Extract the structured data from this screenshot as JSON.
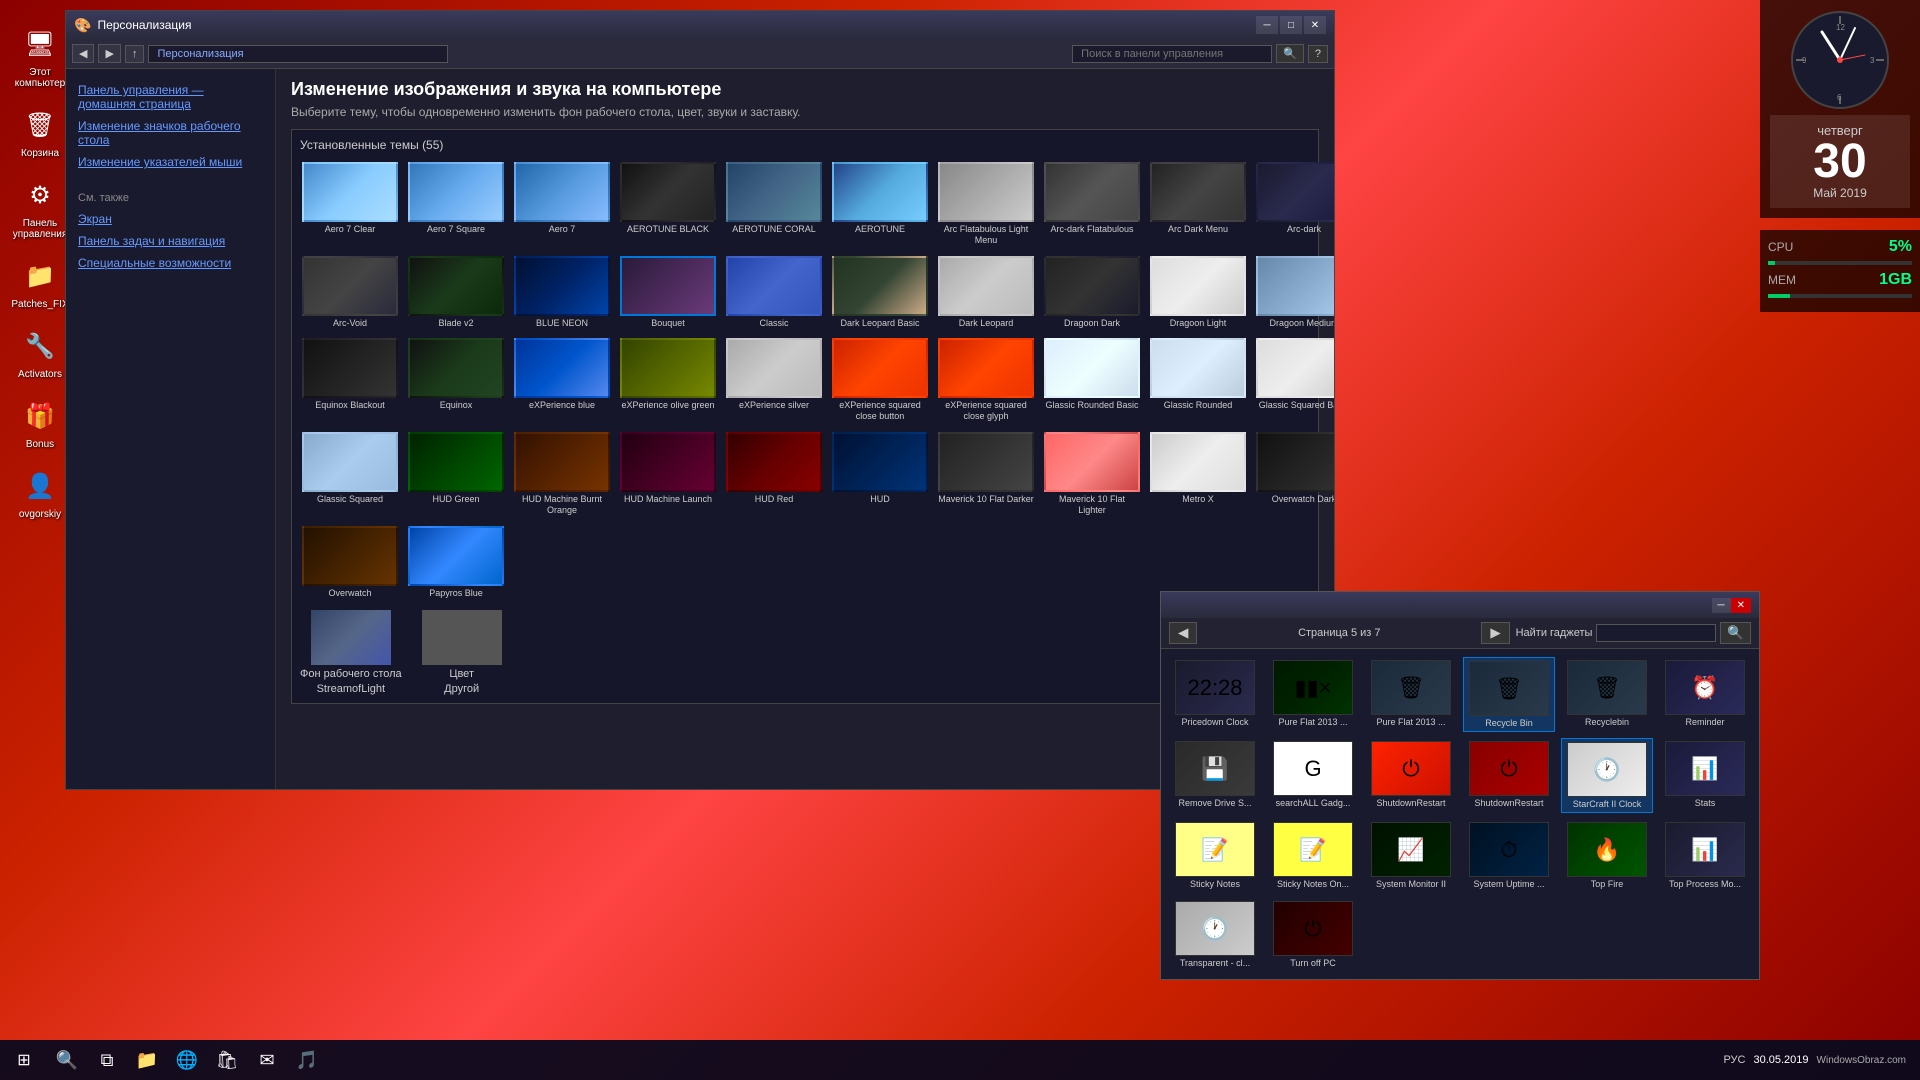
{
  "app": {
    "title": "Персонализация",
    "nav_path": "Персонализация",
    "search_placeholder": "Поиск в панели управления"
  },
  "sidebar": {
    "main_link": "Панель управления — домашняя страница",
    "link1": "Изменение значков рабочего стола",
    "link2": "Изменение указателей мыши",
    "see_also": "См. также",
    "sub_links": [
      "Экран",
      "Панель задач и навигация",
      "Специальные возможности"
    ]
  },
  "main": {
    "title": "Изменение изображения и звука на компьютере",
    "subtitle": "Выберите тему, чтобы одновременно изменить фон рабочего стола, цвет, звуки и заставку.",
    "themes_label": "Установленные темы (55)"
  },
  "themes": [
    {
      "name": "Aero 7 Clear",
      "class": "thumb-aero7clear"
    },
    {
      "name": "Aero 7 Square",
      "class": "thumb-aero7sq"
    },
    {
      "name": "Aero 7",
      "class": "thumb-aero7"
    },
    {
      "name": "AEROTUNE BLACK",
      "class": "thumb-aeroblack"
    },
    {
      "name": "AEROTUNE CORAL",
      "class": "thumb-aerocoral"
    },
    {
      "name": "AEROTUNE",
      "class": "thumb-aerotune"
    },
    {
      "name": "Arc Flatabulous Light Menu",
      "class": "thumb-arcflat"
    },
    {
      "name": "Arc-dark Flatabulous",
      "class": "thumb-arcdarkflat"
    },
    {
      "name": "Arc Dark Menu",
      "class": "thumb-arcdark2"
    },
    {
      "name": "Arc-dark",
      "class": "thumb-arcdark"
    },
    {
      "name": "Arc-Void",
      "class": "thumb-arcvoid"
    },
    {
      "name": "Blade v2",
      "class": "thumb-blade"
    },
    {
      "name": "BLUE NEON",
      "class": "thumb-blueneon"
    },
    {
      "name": "Bouquet",
      "class": "thumb-bouquet",
      "selected": true
    },
    {
      "name": "Classic",
      "class": "thumb-classic"
    },
    {
      "name": "Dark Leopard Basic",
      "class": "thumb-darkleopard"
    },
    {
      "name": "Dark Leopard",
      "class": "thumb-darkleopard2"
    },
    {
      "name": "Dragoon Dark",
      "class": "thumb-dragoondark"
    },
    {
      "name": "Dragoon Light",
      "class": "thumb-dragoonlight"
    },
    {
      "name": "Dragoon Medium",
      "class": "thumb-dragoonmed"
    },
    {
      "name": "Equinox Blackout",
      "class": "thumb-equinoxblack"
    },
    {
      "name": "Equinox",
      "class": "thumb-equinox"
    },
    {
      "name": "eXPerience blue",
      "class": "thumb-expblue"
    },
    {
      "name": "eXPerience olive green",
      "class": "thumb-expolive"
    },
    {
      "name": "eXPerience silver",
      "class": "thumb-expsilver"
    },
    {
      "name": "eXPerience squared close button",
      "class": "thumb-expsqbtn"
    },
    {
      "name": "eXPerience squared close glyph",
      "class": "thumb-expsqglyph"
    },
    {
      "name": "Glassic Rounded Basic",
      "class": "thumb-glassicround"
    },
    {
      "name": "Glassic Rounded",
      "class": "thumb-glassicround2"
    },
    {
      "name": "Glassic Squared Basic",
      "class": "thumb-glasscisqbasic"
    },
    {
      "name": "Glassic Squared",
      "class": "thumb-glasscisq"
    },
    {
      "name": "HUD Green",
      "class": "thumb-hudgreen"
    },
    {
      "name": "HUD Machine Burnt Orange",
      "class": "thumb-hudburnt"
    },
    {
      "name": "HUD Machine Launch",
      "class": "thumb-hudlaunch"
    },
    {
      "name": "HUD Red",
      "class": "thumb-hudred"
    },
    {
      "name": "HUD",
      "class": "thumb-hud"
    },
    {
      "name": "Maverick 10 Flat Darker",
      "class": "thumb-mav10dark"
    },
    {
      "name": "Maverick 10 Flat Lighter",
      "class": "thumb-mav10light"
    },
    {
      "name": "Metro X",
      "class": "thumb-metro"
    },
    {
      "name": "Overwatch Dark",
      "class": "thumb-owdark"
    },
    {
      "name": "Overwatch",
      "class": "thumb-ow"
    },
    {
      "name": "Papyros Blue",
      "class": "thumb-papyros"
    }
  ],
  "fon": {
    "label1": "Фон рабочего стола",
    "label2": "StreamofLight",
    "label3": "Цвет",
    "label4": "Другой"
  },
  "clock": {
    "day": "четверг",
    "number": "30",
    "month": "Май 2019"
  },
  "cpu": {
    "label": "CPU",
    "value": "5",
    "unit": "%",
    "bar": 5
  },
  "mem": {
    "label": "MEM",
    "value": "1",
    "unit": "GB",
    "bar": 15
  },
  "gadgets": {
    "window_title": "",
    "page_info": "Страница 5 из 7",
    "find_label": "Найти гаджеты",
    "items": [
      {
        "name": "Pricedown Clock",
        "class": "g-clock",
        "icon": "22:28"
      },
      {
        "name": "Pure Flat 2013 ...",
        "class": "g-cpu",
        "icon": "▮▮×"
      },
      {
        "name": "Pure Flat 2013 ...",
        "class": "g-recyclebin",
        "icon": "🗑"
      },
      {
        "name": "Recycle Bin",
        "class": "g-recycle",
        "icon": "🗑",
        "highlighted": true
      },
      {
        "name": "Recyclebin",
        "class": "g-recyclebin",
        "icon": "🗑"
      },
      {
        "name": "Reminder",
        "class": "g-reminder",
        "icon": "⏰"
      },
      {
        "name": "Remove Drive S...",
        "class": "g-drive",
        "icon": "💾"
      },
      {
        "name": "searchALL Gadg...",
        "class": "g-search",
        "icon": "G"
      },
      {
        "name": "ShutdownRestart",
        "class": "g-shutdown",
        "icon": "⏻"
      },
      {
        "name": "ShutdownRestart",
        "class": "g-shutdown2",
        "icon": "⏻"
      },
      {
        "name": "StarCraft II Clock",
        "class": "g-analog",
        "icon": "🕐",
        "highlighted": true
      },
      {
        "name": "Stats",
        "class": "g-stats",
        "icon": "📊"
      },
      {
        "name": "Sticky Notes",
        "class": "g-sticky",
        "icon": "📝"
      },
      {
        "name": "Sticky Notes On...",
        "class": "g-stickyOn",
        "icon": "📝"
      },
      {
        "name": "System Monitor II",
        "class": "g-sysMon",
        "icon": "📈"
      },
      {
        "name": "System Uptime ...",
        "class": "g-sysUp",
        "icon": "⏱"
      },
      {
        "name": "Top Fire",
        "class": "g-topfire",
        "icon": "🔥"
      },
      {
        "name": "Top Process Mo...",
        "class": "g-topprocess",
        "icon": "📊"
      },
      {
        "name": "Transparent - cl...",
        "class": "g-transparent",
        "icon": "🕐"
      },
      {
        "name": "Turn off PC",
        "class": "g-turnoff",
        "icon": "⏻"
      }
    ]
  },
  "desktop_icons": [
    {
      "label": "Этот компьютер",
      "icon": "🖥"
    },
    {
      "label": "Корзина",
      "icon": "🗑"
    },
    {
      "label": "Панель управления",
      "icon": "⚙"
    },
    {
      "label": "Patches_FIX",
      "icon": "📁"
    },
    {
      "label": "Activators",
      "icon": "🔧"
    },
    {
      "label": "Bonus",
      "icon": "🎁"
    },
    {
      "label": "ovgorskiy",
      "icon": "👤"
    }
  ],
  "taskbar": {
    "time": "30.05.2019",
    "time2": "РУС",
    "windows_btn": "WindowsObraz.com"
  }
}
